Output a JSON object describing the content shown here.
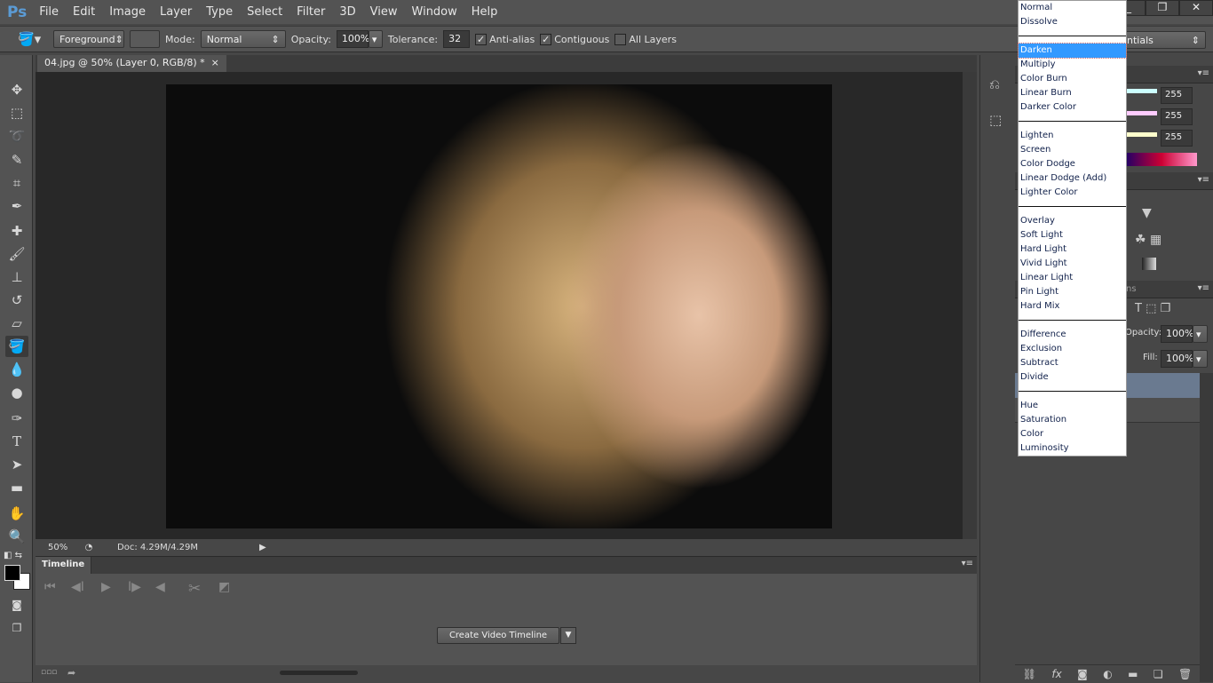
{
  "app": {
    "logo": "Ps",
    "menus": [
      "File",
      "Edit",
      "Image",
      "Layer",
      "Type",
      "Select",
      "Filter",
      "3D",
      "View",
      "Window",
      "Help"
    ],
    "window_controls": [
      "_",
      "❐",
      "✕"
    ]
  },
  "options": {
    "fill_source": "Foreground",
    "mode_label": "Mode:",
    "mode_value": "Normal",
    "opacity_label": "Opacity:",
    "opacity_value": "100%",
    "tolerance_label": "Tolerance:",
    "tolerance_value": "32",
    "anti_alias": {
      "label": "Anti-alias",
      "checked": true
    },
    "contiguous": {
      "label": "Contiguous",
      "checked": true
    },
    "all_layers": {
      "label": "All Layers",
      "checked": false
    },
    "workspace_partial": "ntials"
  },
  "document": {
    "tab_title": "04.jpg @ 50% (Layer 0, RGB/8) *",
    "close": "×"
  },
  "status": {
    "zoom": "50%",
    "doc": "Doc: 4.29M/4.29M"
  },
  "timeline": {
    "tab": "Timeline",
    "create_button": "Create Video Timeline"
  },
  "color_panel": {
    "values": [
      "255",
      "255",
      "255"
    ]
  },
  "layers_panel": {
    "opacity_label": "Opacity:",
    "opacity_value": "100%",
    "fill_label": "Fill:",
    "fill_value": "100%",
    "tab_partial": "ns"
  },
  "blend_dropdown": {
    "selected": "Darken",
    "groups": [
      [
        "Normal",
        "Dissolve"
      ],
      [
        "Darken",
        "Multiply",
        "Color Burn",
        "Linear Burn",
        "Darker Color"
      ],
      [
        "Lighten",
        "Screen",
        "Color Dodge",
        "Linear Dodge (Add)",
        "Lighter Color"
      ],
      [
        "Overlay",
        "Soft Light",
        "Hard Light",
        "Vivid Light",
        "Linear Light",
        "Pin Light",
        "Hard Mix"
      ],
      [
        "Difference",
        "Exclusion",
        "Subtract",
        "Divide"
      ],
      [
        "Hue",
        "Saturation",
        "Color",
        "Luminosity"
      ]
    ]
  },
  "colors": {
    "accent": "#3399ff",
    "foreground": "#000000",
    "background": "#ffffff",
    "selected_layer": "#6a7a90"
  }
}
